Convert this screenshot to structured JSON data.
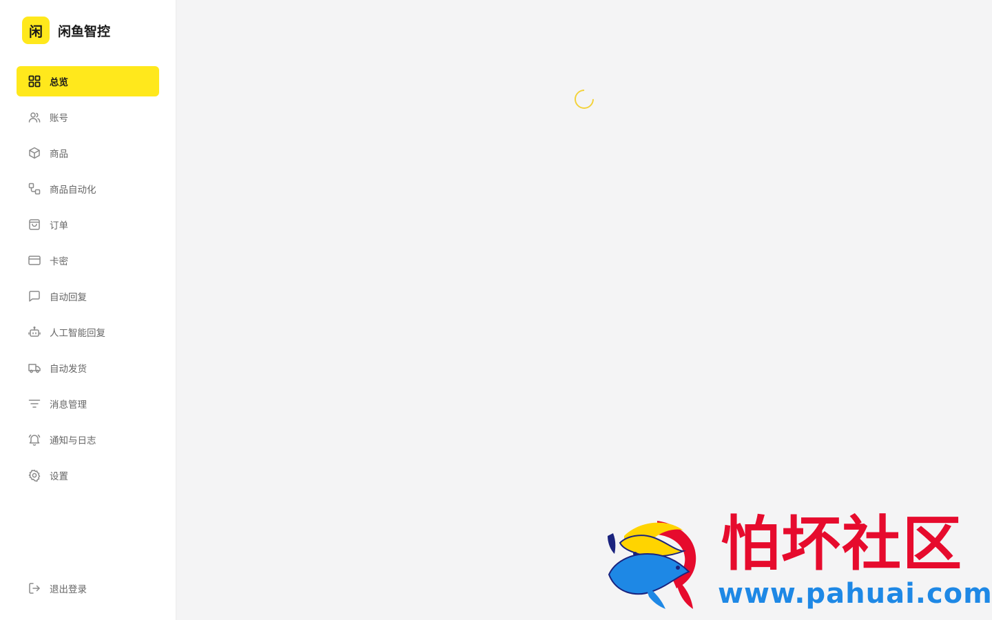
{
  "brand": {
    "logo_char": "闲",
    "title": "闲鱼智控",
    "color": "#ffe81c"
  },
  "nav": [
    {
      "id": "overview",
      "label": "总览",
      "icon": "dashboard-grid-icon",
      "active": true
    },
    {
      "id": "accounts",
      "label": "账号",
      "icon": "users-icon",
      "active": false
    },
    {
      "id": "products",
      "label": "商品",
      "icon": "box-icon",
      "active": false
    },
    {
      "id": "product-automation",
      "label": "商品自动化",
      "icon": "workflow-icon",
      "active": false
    },
    {
      "id": "orders",
      "label": "订单",
      "icon": "shopping-bag-icon",
      "active": false
    },
    {
      "id": "cards",
      "label": "卡密",
      "icon": "credit-card-icon",
      "active": false
    },
    {
      "id": "auto-reply",
      "label": "自动回复",
      "icon": "chat-bubble-icon",
      "active": false
    },
    {
      "id": "ai-reply",
      "label": "人工智能回复",
      "icon": "robot-icon",
      "active": false
    },
    {
      "id": "auto-ship",
      "label": "自动发货",
      "icon": "truck-icon",
      "active": false
    },
    {
      "id": "messages",
      "label": "消息管理",
      "icon": "filter-lines-icon",
      "active": false
    },
    {
      "id": "notifications",
      "label": "通知与日志",
      "icon": "bell-icon",
      "active": false
    },
    {
      "id": "settings",
      "label": "设置",
      "icon": "gear-icon",
      "active": false
    }
  ],
  "logout": {
    "label": "退出登录",
    "icon": "logout-icon"
  },
  "main": {
    "loading": true,
    "spinner_color": "#f3d23a"
  },
  "watermark": {
    "text": "怕坏社区",
    "url": "www.pahuai.com",
    "text_color": "#e60b2d",
    "url_color": "#1e88e5"
  }
}
